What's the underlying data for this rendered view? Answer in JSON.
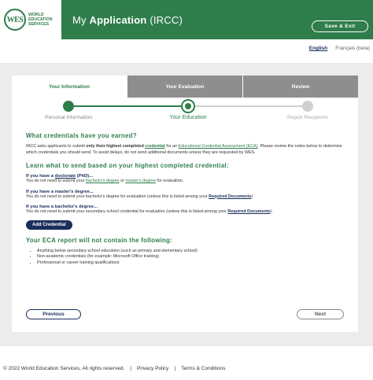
{
  "header": {
    "logo_letters": "WES",
    "logo_lines": [
      "WORLD",
      "EDUCATION",
      "SERVICES"
    ],
    "title_prefix": "My ",
    "title_bold": "Application",
    "title_suffix": " (IRCC)",
    "save_exit": "Save & Exit"
  },
  "language": {
    "english": "English",
    "french": "Français (beta)"
  },
  "tabs": [
    {
      "label": "Your Information",
      "active": true
    },
    {
      "label": "Your Evaluation",
      "active": false
    },
    {
      "label": "Review",
      "active": false
    }
  ],
  "stepper": [
    {
      "label": "Personal Information",
      "state": "done"
    },
    {
      "label": "Your Education",
      "state": "current"
    },
    {
      "label": "Report Recipients",
      "state": "upcoming"
    }
  ],
  "content": {
    "h1": "What credentials have you earned?",
    "intro_a": "IRCC asks applicants to submit ",
    "intro_bold": "only their highest completed ",
    "intro_bold_link": "credential",
    "intro_b": " for an ",
    "intro_link": "Educational Credential Assessment (ECA)",
    "intro_c": ". Please review the notes below to determine which credentials you should send. To avoid delays, do not send additional documents unless they are requested by WES.",
    "h2": "Learn what to send based on your highest completed credential:",
    "q1_a": "If you have a ",
    "q1_link": "doctorate",
    "q1_b": " (PhD)...",
    "a1_a": "You do not need to submit your ",
    "a1_link1": "bachelor's degree",
    "a1_b": " or ",
    "a1_link2": "master's degree",
    "a1_c": " for evaluation.",
    "q2": "If you have a master's degree...",
    "a2_a": "You do not need to submit your bachelor's degree for evaluation (unless this is listed among your ",
    "a2_link": "Required Documents",
    "a2_b": ")",
    "q3": "If you have a bachelor's degree...",
    "a3_a": "You do not need to submit your secondary school credential for evaluation (unless this is listed among your ",
    "a3_link": "Required Documents",
    "a3_b": ").",
    "add_credential": "Add Credential",
    "h3": "Your ECA report will not contain the following:",
    "bullets": [
      "Anything below secondary school education (such as primary and elementary school)",
      "Non-academic credentials (for example: Microsoft Office training)",
      "Professional or career training qualifications"
    ],
    "previous": "Previous",
    "next": "Next"
  },
  "footer": {
    "copyright": "© 2022 World Education Services. All rights reserved.",
    "privacy": "Privacy Policy",
    "terms": "Terms & Conditions",
    "separator": "|"
  },
  "colors": {
    "brand_green": "#2f7d4b",
    "navy": "#1a2e5a",
    "tab_gray": "#8e8e8e"
  }
}
